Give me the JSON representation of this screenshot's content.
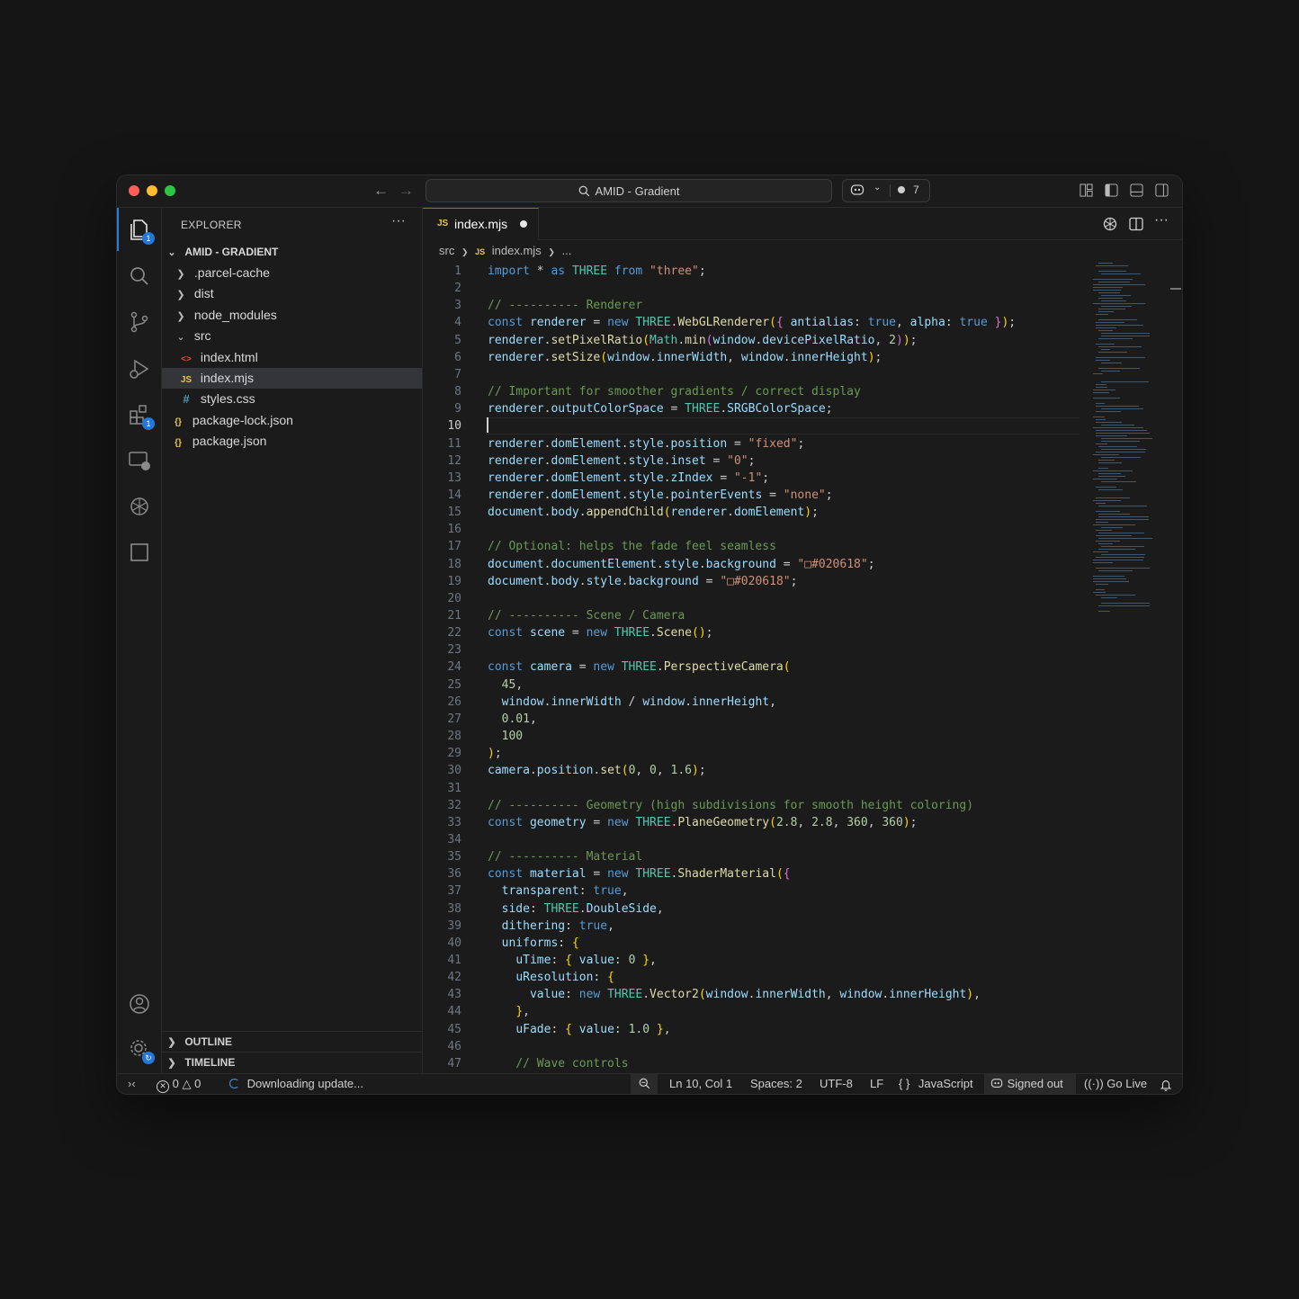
{
  "window": {
    "title": "AMID - Gradient",
    "session_count": "7",
    "colors": {
      "accent": "#2f7bd8",
      "badge": "#2277d8"
    }
  },
  "activity_bar": {
    "items": [
      {
        "name": "explorer-icon",
        "badge": "1"
      },
      {
        "name": "search-icon"
      },
      {
        "name": "source-control-icon"
      },
      {
        "name": "run-debug-icon"
      },
      {
        "name": "extensions-icon",
        "badge": "1"
      },
      {
        "name": "remote-explorer-icon"
      },
      {
        "name": "openai-icon"
      },
      {
        "name": "square-icon"
      }
    ],
    "bottom": [
      {
        "name": "account-icon"
      },
      {
        "name": "settings-gear-icon"
      }
    ]
  },
  "sidebar": {
    "title": "EXPLORER",
    "menu": "···",
    "root": "AMID - GRADIENT",
    "tree": [
      {
        "label": ".parcel-cache",
        "type": "folder",
        "depth": 1,
        "open": false
      },
      {
        "label": "dist",
        "type": "folder",
        "depth": 1,
        "open": false
      },
      {
        "label": "node_modules",
        "type": "folder",
        "depth": 1,
        "open": false
      },
      {
        "label": "src",
        "type": "folder",
        "depth": 1,
        "open": true
      },
      {
        "label": "index.html",
        "type": "html",
        "icon": "<>",
        "depth": 2
      },
      {
        "label": "index.mjs",
        "type": "js",
        "icon": "JS",
        "depth": 2,
        "selected": true
      },
      {
        "label": "styles.css",
        "type": "css",
        "icon": "#",
        "depth": 2
      },
      {
        "label": "package-lock.json",
        "type": "json",
        "icon": "{}",
        "depth": 1
      },
      {
        "label": "package.json",
        "type": "json",
        "icon": "{}",
        "depth": 1
      }
    ],
    "sections": [
      "OUTLINE",
      "TIMELINE"
    ]
  },
  "editor": {
    "tab": {
      "icon": "JS",
      "label": "index.mjs"
    },
    "breadcrumb": [
      "src",
      "index.mjs",
      "..."
    ],
    "breadcrumb_icon": "JS",
    "current_line": 10,
    "lines": [
      "import * as THREE from \"three\";",
      "",
      "// ---------- Renderer",
      "const renderer = new THREE.WebGLRenderer({ antialias: true, alpha: true });",
      "renderer.setPixelRatio(Math.min(window.devicePixelRatio, 2));",
      "renderer.setSize(window.innerWidth, window.innerHeight);",
      "",
      "// Important for smoother gradients / correct display",
      "renderer.outputColorSpace = THREE.SRGBColorSpace;",
      "",
      "renderer.domElement.style.position = \"fixed\";",
      "renderer.domElement.style.inset = \"0\";",
      "renderer.domElement.style.zIndex = \"-1\";",
      "renderer.domElement.style.pointerEvents = \"none\";",
      "document.body.appendChild(renderer.domElement);",
      "",
      "// Optional: helps the fade feel seamless",
      "document.documentElement.style.background = \"□#020618\";",
      "document.body.style.background = \"□#020618\";",
      "",
      "// ---------- Scene / Camera",
      "const scene = new THREE.Scene();",
      "",
      "const camera = new THREE.PerspectiveCamera(",
      "  45,",
      "  window.innerWidth / window.innerHeight,",
      "  0.01,",
      "  100",
      ");",
      "camera.position.set(0, 0, 1.6);",
      "",
      "// ---------- Geometry (high subdivisions for smooth height coloring)",
      "const geometry = new THREE.PlaneGeometry(2.8, 2.8, 360, 360);",
      "",
      "// ---------- Material",
      "const material = new THREE.ShaderMaterial({",
      "  transparent: true,",
      "  side: THREE.DoubleSide,",
      "  dithering: true,",
      "  uniforms: {",
      "    uTime: { value: 0 },",
      "    uResolution: {",
      "      value: new THREE.Vector2(window.innerWidth, window.innerHeight),",
      "    },",
      "    uFade: { value: 1.0 },",
      "",
      "    // Wave controls"
    ]
  },
  "status_bar": {
    "errors": "0",
    "warnings": "0",
    "message": "Downloading update...",
    "position": "Ln 10, Col 1",
    "spaces": "Spaces: 2",
    "encoding": "UTF-8",
    "eol": "LF",
    "language_icon": "{ }",
    "language": "JavaScript",
    "account": "Signed out",
    "golive": "Go Live"
  }
}
